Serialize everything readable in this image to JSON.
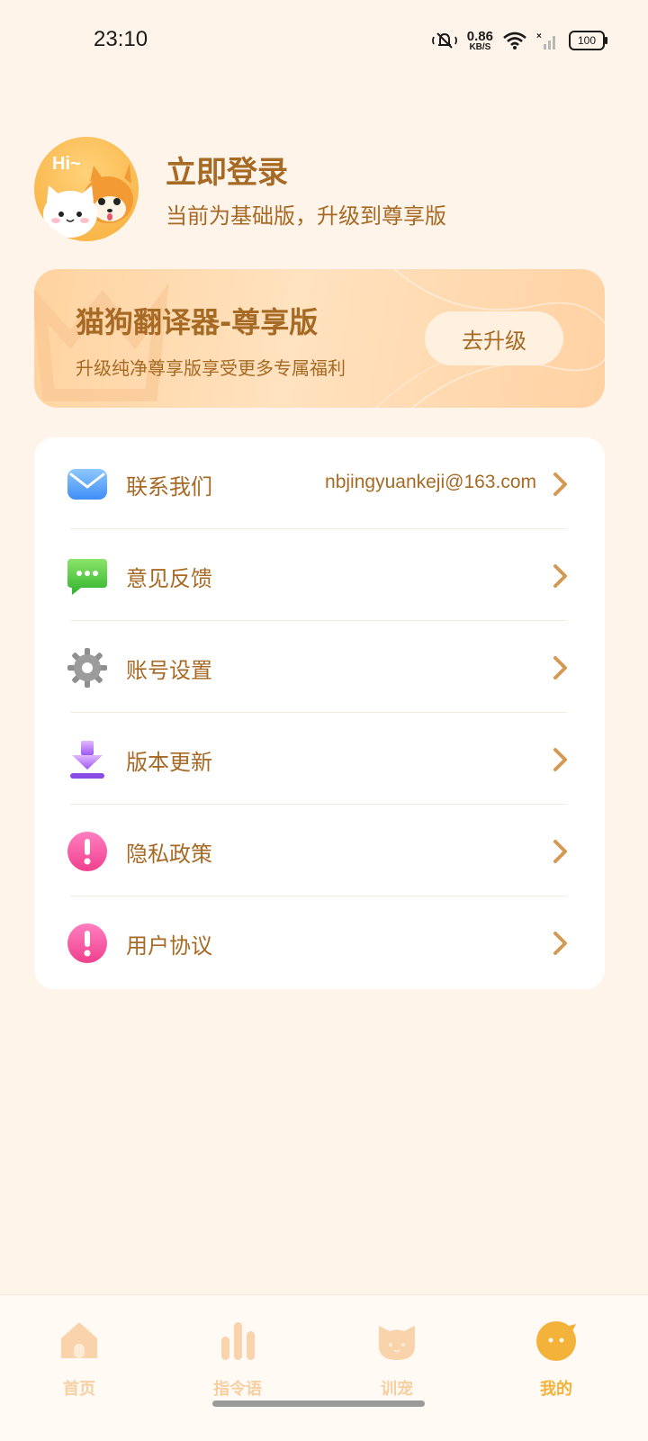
{
  "status_bar": {
    "time": "23:10",
    "net_speed": "0.86",
    "net_unit": "KB/S",
    "battery": "100",
    "icons": [
      "mute-icon",
      "wifi-icon",
      "signal-icon",
      "battery-icon"
    ]
  },
  "profile": {
    "avatar_text": "Hi~",
    "title": "立即登录",
    "subtitle": "当前为基础版，升级到尊享版"
  },
  "vip_banner": {
    "title": "猫狗翻译器-尊享版",
    "subtitle": "升级纯净尊享版享受更多专属福利",
    "button": "去升级"
  },
  "menu": {
    "items": [
      {
        "label": "联系我们",
        "value": "nbjingyuankeji@163.com",
        "icon": "mail-icon"
      },
      {
        "label": "意见反馈",
        "value": "",
        "icon": "chat-bubble-icon"
      },
      {
        "label": "账号设置",
        "value": "",
        "icon": "gear-icon"
      },
      {
        "label": "版本更新",
        "value": "",
        "icon": "download-icon"
      },
      {
        "label": "隐私政策",
        "value": "",
        "icon": "exclamation-icon"
      },
      {
        "label": "用户协议",
        "value": "",
        "icon": "exclamation-icon"
      }
    ]
  },
  "bottom_nav": {
    "items": [
      {
        "label": "首页",
        "icon": "home-icon",
        "active": false
      },
      {
        "label": "指令语",
        "icon": "bar-chart-icon",
        "active": false
      },
      {
        "label": "训宠",
        "icon": "cat-face-icon",
        "active": false
      },
      {
        "label": "我的",
        "icon": "profile-face-icon",
        "active": true
      }
    ]
  },
  "colors": {
    "background": "#fff4ea",
    "accent_text": "#a66a25",
    "nav_inactive": "#f6cfa2",
    "nav_active": "#f3b23a"
  }
}
